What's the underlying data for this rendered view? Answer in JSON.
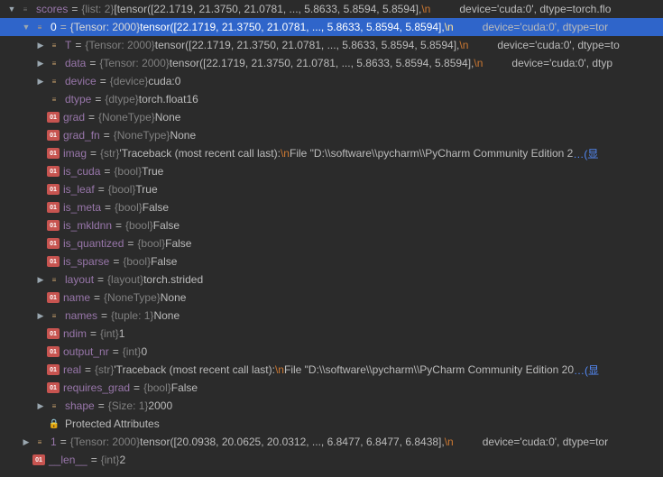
{
  "rows": [
    {
      "indent": 0,
      "arrow": "down",
      "icon": "list",
      "name": "scores",
      "type": "{list: 2}",
      "val": "[tensor([22.1719, 21.3750, 21.0781,  ...,  5.8633,  5.8594,  5.8594],",
      "esc": "\\n",
      "after": "       device='cuda:0', dtype=torch.flo",
      "gap": 32
    },
    {
      "indent": 1,
      "arrow": "down",
      "icon": "obj",
      "name": "0",
      "type": "{Tensor: 2000}",
      "val": "tensor([22.1719, 21.3750, 21.0781,  ...,  5.8633,  5.8594,  5.8594],",
      "esc": "\\n",
      "after": "       device='cuda:0', dtype=tor",
      "selected": true,
      "gap": 32
    },
    {
      "indent": 2,
      "arrow": "right",
      "icon": "obj",
      "name": "T",
      "type": "{Tensor: 2000}",
      "val": "tensor([22.1719, 21.3750, 21.0781,  ...,  5.8633,  5.8594,  5.8594],",
      "esc": "\\n",
      "after": "       device='cuda:0', dtype=to",
      "gap": 32
    },
    {
      "indent": 2,
      "arrow": "right",
      "icon": "obj",
      "name": "data",
      "type": "{Tensor: 2000}",
      "val": "tensor([22.1719, 21.3750, 21.0781,  ...,  5.8633,  5.8594,  5.8594],",
      "esc": "\\n",
      "after": "       device='cuda:0', dtyp",
      "gap": 32
    },
    {
      "indent": 2,
      "arrow": "right",
      "icon": "obj",
      "name": "device",
      "type": "{device}",
      "val": "cuda:0",
      "gap": 0
    },
    {
      "indent": 2,
      "arrow": "none",
      "icon": "obj",
      "name": "dtype",
      "type": "{dtype}",
      "val": "torch.float16",
      "gap": 0
    },
    {
      "indent": 2,
      "arrow": "none",
      "icon": "field",
      "name": "grad",
      "type": "{NoneType}",
      "val": "None",
      "gap": 0
    },
    {
      "indent": 2,
      "arrow": "none",
      "icon": "field",
      "name": "grad_fn",
      "type": "{NoneType}",
      "val": "None",
      "gap": 0
    },
    {
      "indent": 2,
      "arrow": "none",
      "icon": "field",
      "name": "imag",
      "type": "{str}",
      "val": "'Traceback (most recent call last):",
      "esc": "\\n",
      "after": "  File \"D:\\\\software\\\\pycharm\\\\PyCharm Community Edition 2",
      "link": "…(显",
      "gap": 0
    },
    {
      "indent": 2,
      "arrow": "none",
      "icon": "field",
      "name": "is_cuda",
      "type": "{bool}",
      "val": "True",
      "gap": 0
    },
    {
      "indent": 2,
      "arrow": "none",
      "icon": "field",
      "name": "is_leaf",
      "type": "{bool}",
      "val": "True",
      "gap": 0
    },
    {
      "indent": 2,
      "arrow": "none",
      "icon": "field",
      "name": "is_meta",
      "type": "{bool}",
      "val": "False",
      "gap": 0
    },
    {
      "indent": 2,
      "arrow": "none",
      "icon": "field",
      "name": "is_mkldnn",
      "type": "{bool}",
      "val": "False",
      "gap": 0
    },
    {
      "indent": 2,
      "arrow": "none",
      "icon": "field",
      "name": "is_quantized",
      "type": "{bool}",
      "val": "False",
      "gap": 0
    },
    {
      "indent": 2,
      "arrow": "none",
      "icon": "field",
      "name": "is_sparse",
      "type": "{bool}",
      "val": "False",
      "gap": 0
    },
    {
      "indent": 2,
      "arrow": "right",
      "icon": "obj",
      "name": "layout",
      "type": "{layout}",
      "val": "torch.strided",
      "gap": 0
    },
    {
      "indent": 2,
      "arrow": "none",
      "icon": "field",
      "name": "name",
      "type": "{NoneType}",
      "val": "None",
      "gap": 0
    },
    {
      "indent": 2,
      "arrow": "right",
      "icon": "obj",
      "name": "names",
      "type": "{tuple: 1}",
      "val": "None",
      "gap": 0
    },
    {
      "indent": 2,
      "arrow": "none",
      "icon": "field",
      "name": "ndim",
      "type": "{int}",
      "val": "1",
      "gap": 0
    },
    {
      "indent": 2,
      "arrow": "none",
      "icon": "field",
      "name": "output_nr",
      "type": "{int}",
      "val": "0",
      "gap": 0
    },
    {
      "indent": 2,
      "arrow": "none",
      "icon": "field",
      "name": "real",
      "type": "{str}",
      "val": "'Traceback (most recent call last):",
      "esc": "\\n",
      "after": "  File \"D:\\\\software\\\\pycharm\\\\PyCharm Community Edition 20",
      "link": "…(显",
      "gap": 0
    },
    {
      "indent": 2,
      "arrow": "none",
      "icon": "field",
      "name": "requires_grad",
      "type": "{bool}",
      "val": "False",
      "gap": 0
    },
    {
      "indent": 2,
      "arrow": "right",
      "icon": "obj",
      "name": "shape",
      "type": "{Size: 1}",
      "val": "2000",
      "gap": 0
    },
    {
      "indent": 2,
      "arrow": "none",
      "icon": "lock",
      "plain": "Protected Attributes"
    },
    {
      "indent": 1,
      "arrow": "right",
      "icon": "obj",
      "name": "1",
      "type": "{Tensor: 2000}",
      "val": "tensor([20.0938, 20.0625, 20.0312,  ...,  6.8477,  6.8477,  6.8438],",
      "esc": "\\n",
      "after": "       device='cuda:0', dtype=tor",
      "gap": 32
    },
    {
      "indent": 1,
      "arrow": "none",
      "icon": "field",
      "name": "__len__",
      "type": "{int}",
      "val": "2",
      "gap": 0
    }
  ]
}
